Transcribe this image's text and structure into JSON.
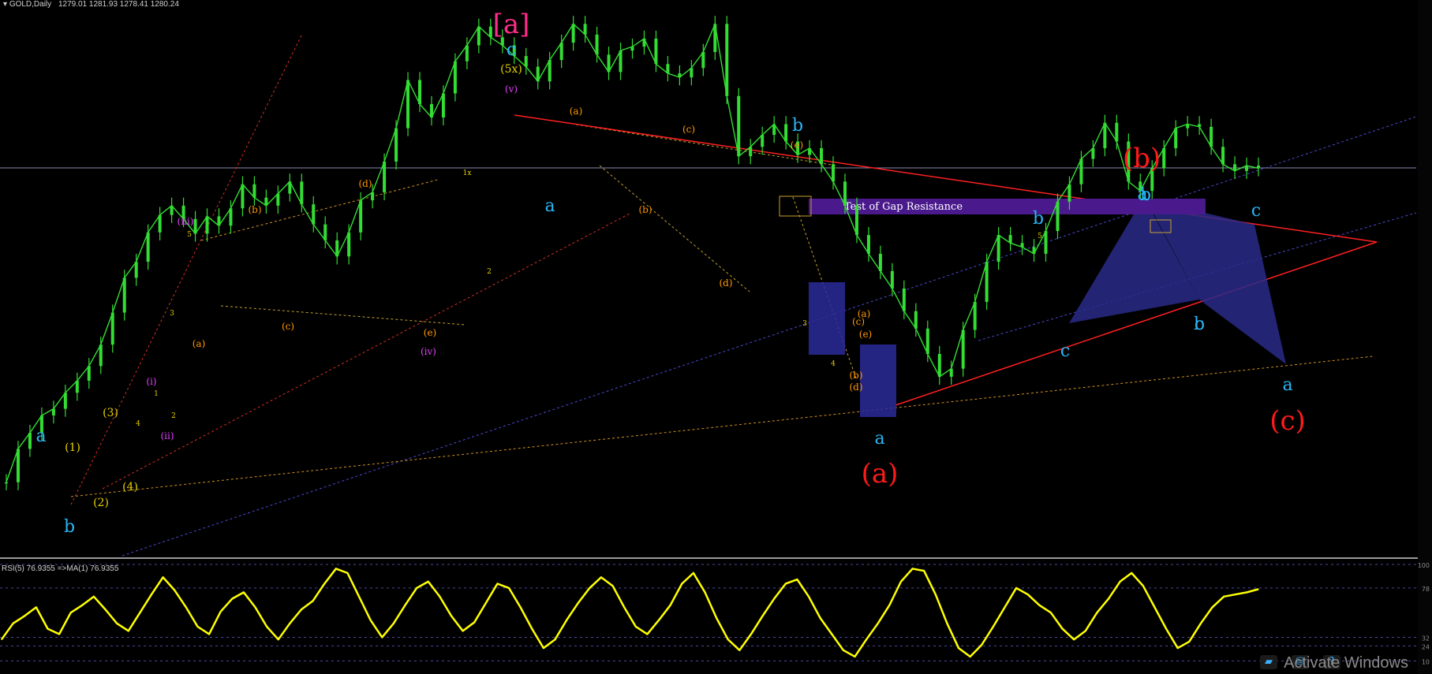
{
  "header": {
    "symbol": "GOLD,Daily",
    "ohlc": "1279.01 1281.93 1278.41 1280.24"
  },
  "rsi_header": "RSI(5) 76.9355  =>MA(1) 76.9355",
  "watermark": "Activate Windows",
  "tray_icons": [
    "nvidia-icon",
    "network-icon",
    "help-icon"
  ],
  "colors": {
    "background": "#000000",
    "candles": "#33dd33",
    "rsi": "#ffff00",
    "resistance_line": "#ff2020",
    "wave_red": "#ff1a1a",
    "wave_blue": "#29b6f6",
    "wave_orange": "#ff9800",
    "wave_yellow": "#e6d200",
    "wave_magenta": "#e040fb",
    "wave_pink": "#ff2d8a",
    "gap_box": "#4a1a8c",
    "pattern_fill": "#2a2a8a"
  },
  "chart_data": [
    {
      "type": "line",
      "subtype": "candlestick",
      "title": "GOLD,Daily",
      "series": [
        {
          "name": "GOLD,Daily",
          "values": [
            1045,
            1070,
            1082,
            1095,
            1100,
            1112,
            1121,
            1132,
            1148,
            1172,
            1198,
            1210,
            1232,
            1245,
            1252,
            1242,
            1231,
            1244,
            1237,
            1250,
            1268,
            1258,
            1252,
            1261,
            1270,
            1253,
            1238,
            1226,
            1214,
            1232,
            1256,
            1262,
            1285,
            1310,
            1346,
            1328,
            1318,
            1336,
            1360,
            1372,
            1386,
            1378,
            1372,
            1364,
            1356,
            1345,
            1361,
            1374,
            1388,
            1380,
            1365,
            1352,
            1368,
            1371,
            1377,
            1358,
            1351,
            1348,
            1355,
            1367,
            1388,
            1334,
            1289,
            1296,
            1305,
            1313,
            1300,
            1290,
            1295,
            1283,
            1270,
            1252,
            1230,
            1216,
            1203,
            1190,
            1173,
            1160,
            1141,
            1124,
            1130,
            1159,
            1180,
            1210,
            1230,
            1224,
            1221,
            1216,
            1233,
            1255,
            1268,
            1287,
            1295,
            1314,
            1300,
            1270,
            1263,
            1280,
            1295,
            1310,
            1313,
            1311,
            1296,
            1283,
            1278,
            1282,
            1280
          ],
          "current": 1280.24
        }
      ],
      "ylim": [
        990,
        1400
      ],
      "grid": false,
      "annotations": {
        "box_label": "Test of Gap Resistance",
        "primary_labels": [
          "[a]",
          "(a)",
          "(b)",
          "(c)"
        ],
        "secondary_labels": [
          "a",
          "b",
          "c",
          "a",
          "b",
          "a",
          "b",
          "c",
          "a",
          "b",
          "c",
          "a",
          "b",
          "c"
        ],
        "impulse_labels": [
          "(1)",
          "(2)",
          "(3)",
          "(4)",
          "(5x)"
        ],
        "minor_labels": [
          "(i)",
          "(ii)",
          "(iii)",
          "(iv)",
          "(v)",
          "(a)",
          "(b)",
          "(c)",
          "(d)",
          "(e)",
          "(a)",
          "(b)",
          "(c)",
          "(d)",
          "(e)",
          "(a)",
          "(b)",
          "(c)",
          "(d)",
          "(e)"
        ],
        "tiny_labels": [
          "1",
          "2",
          "3",
          "4",
          "5",
          "1x",
          "2",
          "3",
          "4",
          "5"
        ]
      }
    },
    {
      "type": "line",
      "title": "RSI(5) 76.9355  =>MA(1) 76.9355",
      "series": [
        {
          "name": "RSI(5)",
          "values": [
            30,
            45,
            52,
            60,
            40,
            35,
            55,
            62,
            70,
            58,
            45,
            38,
            55,
            72,
            88,
            76,
            60,
            42,
            35,
            56,
            68,
            74,
            60,
            42,
            30,
            45,
            58,
            66,
            82,
            96,
            92,
            70,
            48,
            32,
            45,
            62,
            78,
            84,
            70,
            52,
            38,
            46,
            64,
            82,
            78,
            60,
            40,
            22,
            30,
            48,
            64,
            78,
            88,
            80,
            60,
            42,
            35,
            48,
            62,
            82,
            92,
            74,
            50,
            30,
            20,
            35,
            52,
            68,
            82,
            86,
            70,
            50,
            35,
            20,
            14,
            30,
            45,
            62,
            84,
            96,
            94,
            72,
            45,
            22,
            14,
            25,
            42,
            60,
            78,
            72,
            62,
            55,
            40,
            30,
            38,
            55,
            68,
            84,
            92,
            80,
            60,
            40,
            22,
            28,
            45,
            60,
            70,
            72,
            74,
            76.9355
          ]
        }
      ],
      "ylim": [
        0,
        100
      ],
      "level_labels": [
        "100",
        "78",
        "32",
        "24",
        "10"
      ]
    }
  ]
}
